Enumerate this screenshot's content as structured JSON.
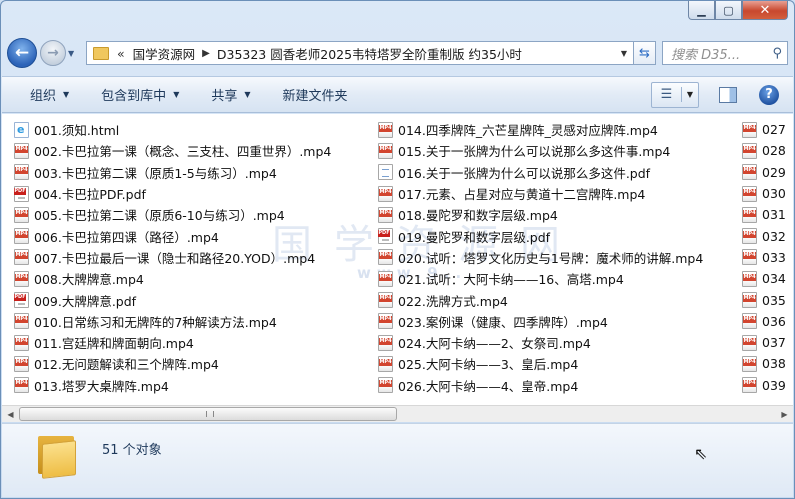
{
  "window": {
    "minimize_glyph": "▁",
    "maximize_glyph": "▢",
    "close_glyph": "✕"
  },
  "nav": {
    "back_glyph": "←",
    "forward_glyph": "→",
    "breadcrumb": [
      "国学资源网",
      "D35323 圆香老师2025韦特塔罗全阶重制版 约35小时"
    ],
    "search_placeholder": "搜索 D35..."
  },
  "toolbar": {
    "organize": "组织",
    "include_library": "包含到库中",
    "share": "共享",
    "new_folder": "新建文件夹"
  },
  "files": {
    "column1": [
      {
        "name": "001.须知.html",
        "type": "html"
      },
      {
        "name": "002.卡巴拉第一课（概念、三支柱、四重世界）.mp4",
        "type": "mp4"
      },
      {
        "name": "003.卡巴拉第二课（原质1-5与练习）.mp4",
        "type": "mp4"
      },
      {
        "name": "004.卡巴拉PDF.pdf",
        "type": "pdf"
      },
      {
        "name": "005.卡巴拉第二课（原质6-10与练习）.mp4",
        "type": "mp4"
      },
      {
        "name": "006.卡巴拉第四课（路径）.mp4",
        "type": "mp4"
      },
      {
        "name": "007.卡巴拉最后一课（隐士和路径20.YOD）.mp4",
        "type": "mp4"
      },
      {
        "name": "008.大牌牌意.mp4",
        "type": "mp4"
      },
      {
        "name": "009.大牌牌意.pdf",
        "type": "pdf"
      },
      {
        "name": "010.日常练习和无牌阵的7种解读方法.mp4",
        "type": "mp4"
      },
      {
        "name": "011.宫廷牌和牌面朝向.mp4",
        "type": "mp4"
      },
      {
        "name": "012.无问题解读和三个牌阵.mp4",
        "type": "mp4"
      },
      {
        "name": "013.塔罗大桌牌阵.mp4",
        "type": "mp4"
      }
    ],
    "column2": [
      {
        "name": "014.四季牌阵_六芒星牌阵_灵感对应牌阵.mp4",
        "type": "mp4"
      },
      {
        "name": "015.关于一张牌为什么可以说那么多这件事.mp4",
        "type": "mp4"
      },
      {
        "name": "016.关于一张牌为什么可以说那么多这件.pdf",
        "type": "doc"
      },
      {
        "name": "017.元素、占星对应与黄道十二宫牌阵.mp4",
        "type": "mp4"
      },
      {
        "name": "018.曼陀罗和数字层级.mp4",
        "type": "mp4"
      },
      {
        "name": "019.曼陀罗和数字层级.pdf",
        "type": "pdf"
      },
      {
        "name": "020.试听：塔罗文化历史与1号牌：魔术师的讲解.mp4",
        "type": "mp4"
      },
      {
        "name": "021.试听：大阿卡纳——16、高塔.mp4",
        "type": "mp4"
      },
      {
        "name": "022.洗牌方式.mp4",
        "type": "mp4"
      },
      {
        "name": "023.案例课（健康、四季牌阵）.mp4",
        "type": "mp4"
      },
      {
        "name": "024.大阿卡纳——2、女祭司.mp4",
        "type": "mp4"
      },
      {
        "name": "025.大阿卡纳——3、皇后.mp4",
        "type": "mp4"
      },
      {
        "name": "026.大阿卡纳——4、皇帝.mp4",
        "type": "mp4"
      }
    ],
    "column3": [
      {
        "name": "027",
        "type": "mp4"
      },
      {
        "name": "028",
        "type": "mp4"
      },
      {
        "name": "029",
        "type": "mp4"
      },
      {
        "name": "030",
        "type": "mp4"
      },
      {
        "name": "031",
        "type": "mp4"
      },
      {
        "name": "032",
        "type": "mp4"
      },
      {
        "name": "033",
        "type": "mp4"
      },
      {
        "name": "034",
        "type": "mp4"
      },
      {
        "name": "035",
        "type": "mp4"
      },
      {
        "name": "036",
        "type": "mp4"
      },
      {
        "name": "037",
        "type": "mp4"
      },
      {
        "name": "038",
        "type": "mp4"
      },
      {
        "name": "039",
        "type": "mp4"
      }
    ]
  },
  "watermark": {
    "main": "国学资源网",
    "sub": "www.9..."
  },
  "status": {
    "count_text": "51 个对象"
  }
}
